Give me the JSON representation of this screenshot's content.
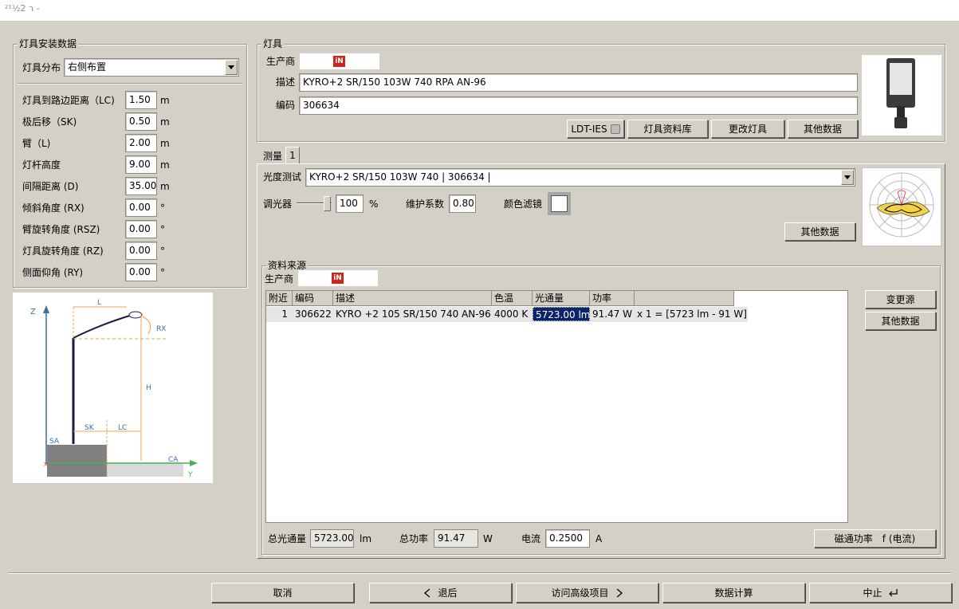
{
  "window": {
    "title": "²¹½2 ר -"
  },
  "install": {
    "legend": "灯具安装数据",
    "dist_label": "灯具分布",
    "dist_value": "右侧布置",
    "rows": [
      {
        "label": "灯具到路边距离（LC)",
        "value": "1.50",
        "unit": "m"
      },
      {
        "label": "极后移（SK)",
        "value": "0.50",
        "unit": "m"
      },
      {
        "label": "臂（L)",
        "value": "2.00",
        "unit": "m"
      },
      {
        "label": "灯杆高度",
        "value": "9.00",
        "unit": "m"
      },
      {
        "label": "间隔距离 (D)",
        "value": "35.00",
        "unit": "m"
      },
      {
        "label": "倾斜角度 (RX)",
        "value": "0.00",
        "unit": "°"
      },
      {
        "label": "臂旋转角度 (RSZ)",
        "value": "0.00",
        "unit": "°"
      },
      {
        "label": "灯具旋转角度 (RZ)",
        "value": "0.00",
        "unit": "°"
      },
      {
        "label": "侧面仰角 (RY)",
        "value": "0.00",
        "unit": "°"
      }
    ]
  },
  "diagram": {
    "z": "Z",
    "l": "L",
    "rx": "RX",
    "h": "H",
    "sk": "SK",
    "lc": "LC",
    "sa": "SA",
    "ca": "CA",
    "y": "Y"
  },
  "luminaire": {
    "legend": "灯具",
    "manufacturer_label": "生产商",
    "logo": "iN",
    "desc_label": "描述",
    "desc_value": "KYRO+2 SR/150 103W 740 RPA AN-96",
    "code_label": "编码",
    "code_value": "306634",
    "btn_ldt": "LDT-IES",
    "btn_db": "灯具资料库",
    "btn_change": "更改灯具",
    "btn_more": "其他数据"
  },
  "measure": {
    "tab_label": "测量",
    "tab_num": "1",
    "photo_label": "光度测试",
    "photo_value": "KYRO+2 SR/150 103W 740 | 306634 |",
    "dimmer_label": "调光器",
    "dimmer_value": "100",
    "dimmer_unit": "%",
    "maint_label": "维护系数",
    "maint_value": "0.80",
    "filter_label": "颜色滤镜",
    "btn_more": "其他数据"
  },
  "source": {
    "legend": "资料来源",
    "manufacturer_label": "生产商",
    "logo": "iN",
    "columns": [
      "附近",
      "编码",
      "描述",
      "色温",
      "光通量",
      "功率",
      ""
    ],
    "rows": [
      {
        "idx": "1",
        "code": "306622",
        "desc": "KYRO +2 105 SR/150 740 AN-96",
        "temp": "4000 K",
        "flux": "5723.00 lm",
        "power": "91.47 W",
        "extra": "x 1 = [5723 lm - 91 W]"
      }
    ],
    "btn_change": "变更源",
    "btn_more": "其他数据",
    "total_flux_label": "总光通量",
    "total_flux_value": "5723.00",
    "total_flux_unit": "lm",
    "total_power_label": "总功率",
    "total_power_value": "91.47",
    "total_power_unit": "W",
    "current_label": "电流",
    "current_value": "0.2500",
    "current_unit": "A",
    "btn_flux_power": "磁通功率　f (电流)"
  },
  "footer": {
    "cancel": "取消",
    "back": "退后",
    "advanced": "访问高级项目",
    "calc": "数据计算",
    "stop": "中止"
  }
}
